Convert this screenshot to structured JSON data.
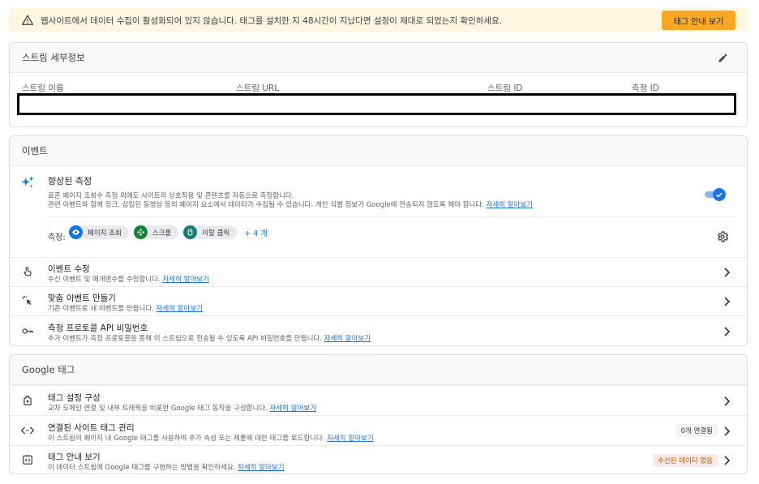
{
  "banner": {
    "message": "웹사이트에서 데이터 수집이 활성화되어 있지 않습니다. 태그를 설치한 지 48시간이 지났다면 설정이 제대로 되었는지 확인하세요.",
    "button": "태그 안내 보기"
  },
  "stream_details": {
    "title": "스트림 세부정보",
    "columns": [
      "스트림 이름",
      "스트림 URL",
      "스트림 ID",
      "측정 ID"
    ]
  },
  "events": {
    "title": "이벤트",
    "enhanced": {
      "title": "향상된 측정",
      "desc_line1": "표준 페이지 조회수 측정 외에도 사이트의 상호작용 및 콘텐츠를 자동으로 측정합니다.",
      "desc_line2": "관련 이벤트와 함께 링크, 삽입된 동영상 등의 페이지 요소에서 데이터가 수집될 수 있습니다. 개인 식별 정보가 Google에 전송되지 않도록 해야 합니다.",
      "link": "자세히 알아보기",
      "toggle_on": true,
      "measure_label": "측정:",
      "chips": [
        "페이지 조회",
        "스크롤",
        "이탈 클릭"
      ],
      "more": "+ 4 개"
    },
    "rows": [
      {
        "title": "이벤트 수정",
        "desc": "수신 이벤트 및 매개변수를 수정합니다.",
        "link": "자세히 알아보기"
      },
      {
        "title": "맞춤 이벤트 만들기",
        "desc": "기존 이벤트로 새 이벤트를 만듭니다.",
        "link": "자세히 알아보기"
      },
      {
        "title": "측정 프로토콜 API 비밀번호",
        "desc": "추가 이벤트가 측정 프로토콜을 통해 이 스트림으로 전송될 수 있도록 API 비밀번호를 만듭니다.",
        "link": "자세히 알아보기"
      }
    ]
  },
  "google_tag": {
    "title": "Google 태그",
    "rows": [
      {
        "title": "태그 설정 구성",
        "desc": "교차 도메인 연결 및 내부 트래픽을 비롯한 Google 태그 동작을 구성합니다.",
        "link": "자세히 알아보기"
      },
      {
        "title": "연결된 사이트 태그 관리",
        "desc": "이 스트림의 페이지 내 Google 태그를 사용하여 추가 속성 또는 제품에 대한 태그를 로드합니다.",
        "link": "자세히 알아보기",
        "badge": "0개 연결됨"
      },
      {
        "title": "태그 안내 보기",
        "desc": "이 데이터 스트림에 Google 태그를 구현하는 방법을 확인하세요.",
        "link": "자세히 알아보기",
        "badge": "수신된 데이터 없음"
      }
    ]
  },
  "colors": {
    "accent": "#1a73e8",
    "banner_bg": "#fef7e0",
    "banner_button": "#f9a825",
    "no_data_badge_bg": "#fce8e6",
    "no_data_badge_text": "#b06000"
  }
}
